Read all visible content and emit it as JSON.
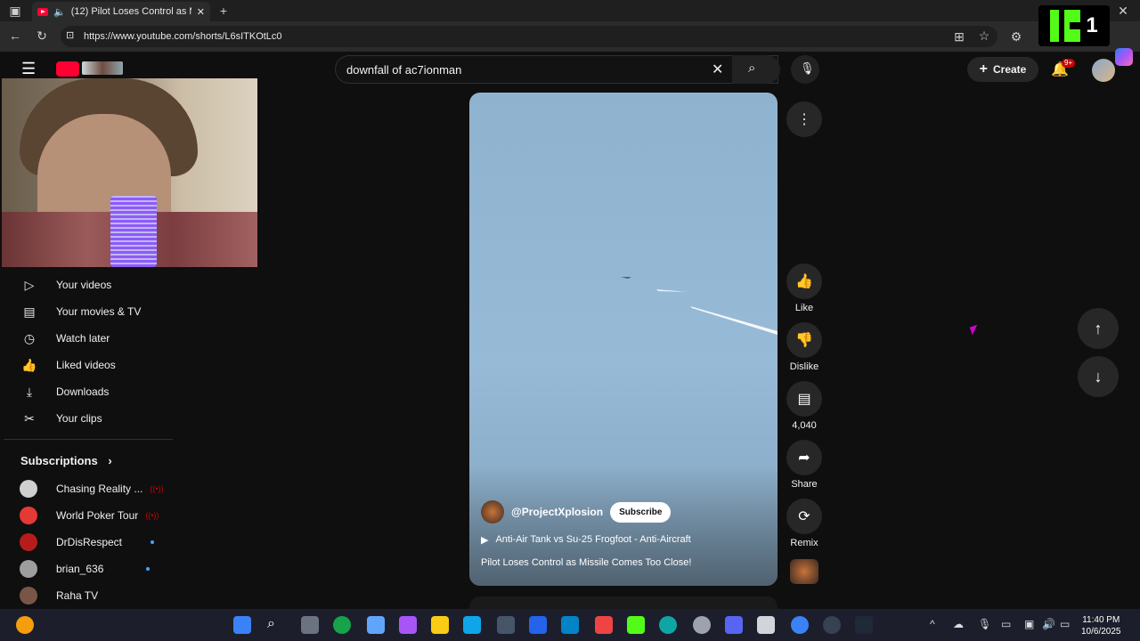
{
  "browser": {
    "tab_title": "(12) Pilot Loses Control as M",
    "url": "https://www.youtube.com/shorts/L6sITKOtLc0"
  },
  "kick_badge": {
    "number": "1"
  },
  "youtube": {
    "search_query": "downfall of ac7ionman",
    "create_label": "Create",
    "notification_count": "9+"
  },
  "sidebar": {
    "items": [
      {
        "label": "Your videos",
        "icon": "play-square-icon"
      },
      {
        "label": "Your movies & TV",
        "icon": "clapper-icon"
      },
      {
        "label": "Watch later",
        "icon": "clock-icon"
      },
      {
        "label": "Liked videos",
        "icon": "thumbs-up-icon"
      },
      {
        "label": "Downloads",
        "icon": "download-icon"
      },
      {
        "label": "Your clips",
        "icon": "scissors-icon"
      }
    ],
    "subscriptions_title": "Subscriptions",
    "subscriptions": [
      {
        "name": "Chasing Reality ...",
        "status": "live",
        "color": "#cfcfcf"
      },
      {
        "name": "World Poker Tour",
        "status": "live",
        "color": "#e53935"
      },
      {
        "name": "DrDisRespect",
        "status": "new",
        "color": "#b71c1c"
      },
      {
        "name": "brian_636",
        "status": "new",
        "color": "#9e9e9e"
      },
      {
        "name": "Raha TV",
        "status": "",
        "color": "#795548"
      }
    ]
  },
  "short": {
    "channel": "@ProjectXplosion",
    "subscribe_label": "Subscribe",
    "playlist": "Anti-Air Tank vs Su-25 Frogfoot - Anti-Aircraft",
    "title": "Pilot Loses Control as Missile Comes Too Close!"
  },
  "actions": {
    "like": "Like",
    "dislike": "Dislike",
    "comments": "4,040",
    "share": "Share",
    "remix": "Remix"
  },
  "taskbar": {
    "time": "11:40 PM",
    "date": "10/6/2025"
  }
}
